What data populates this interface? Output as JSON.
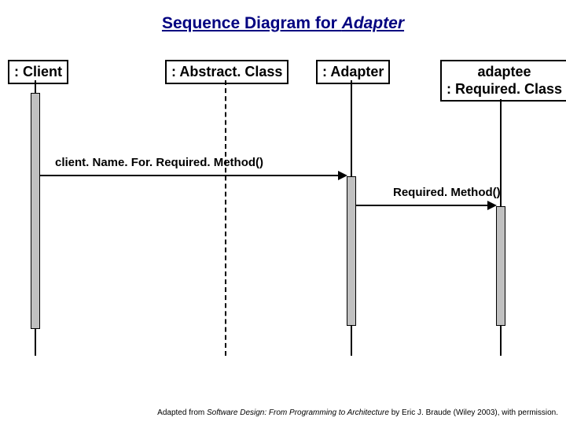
{
  "title_prefix": "Sequence Diagram for ",
  "title_italic": "Adapter",
  "participants": {
    "client": ": Client",
    "abstract": ": Abstract. Class",
    "adapter": ": Adapter",
    "adaptee_line1": "adaptee",
    "adaptee_line2": ": Required. Class"
  },
  "messages": {
    "msg1": "client. Name. For. Required. Method()",
    "msg2": "Required. Method()"
  },
  "footer_prefix": "Adapted from ",
  "footer_book": "Software Design: From Programming to Architecture",
  "footer_suffix": " by Eric J. Braude (Wiley 2003), with permission."
}
